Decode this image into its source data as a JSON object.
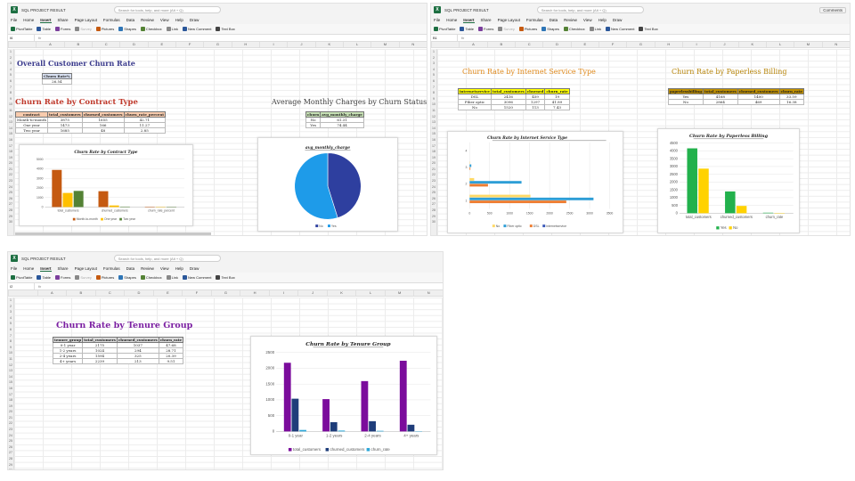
{
  "app": {
    "file_title": "SQL PROJECT RESULT",
    "search_placeholder": "Search for tools, help, and more (Alt + Q)",
    "menu": [
      "File",
      "Home",
      "Insert",
      "Share",
      "Page Layout",
      "Formulas",
      "Data",
      "Review",
      "View",
      "Help",
      "Draw"
    ],
    "active_menu": "Insert",
    "toolbar": [
      "PivotTable",
      "Table",
      "Forms",
      "Survey",
      "Pictures",
      "Shapes",
      "Checkbox",
      "Link",
      "New Comment",
      "Text Box"
    ],
    "comments_label": "Comments",
    "columns": [
      "A",
      "B",
      "C",
      "D",
      "E",
      "F",
      "G",
      "H",
      "I",
      "J",
      "K",
      "L",
      "M",
      "N"
    ]
  },
  "shot_a": {
    "cell_ref": "I6",
    "title_overall": "Overall Customer Churn Rate",
    "overall_header": "Churn Rate%",
    "overall_value": "26.54",
    "title_contract": "Churn Rate by Contract Type",
    "contract_headers": [
      "contract",
      "total_customers",
      "churned_customers",
      "churn_rate_percent"
    ],
    "contract_rows": [
      [
        "Month-to-month",
        "3875",
        "1655",
        "42.71"
      ],
      [
        "One year",
        "1473",
        "166",
        "11.27"
      ],
      [
        "Two year",
        "1685",
        "48",
        "2.85"
      ]
    ],
    "title_monthly": "Average Monthly Charges by Churn Status",
    "monthly_headers": [
      "churn",
      "avg_monthly_charge"
    ],
    "monthly_rows": [
      [
        "No",
        "61.31"
      ],
      [
        "Yes",
        "74.44"
      ]
    ]
  },
  "shot_b": {
    "cell_ref": "B1",
    "title_internet": "Churn Rate by Internet Service Type",
    "internet_headers": [
      "internetservice",
      "total_customers",
      "churned",
      "churn_rate"
    ],
    "internet_rows": [
      [
        "DSL",
        "2416",
        "459",
        "19"
      ],
      [
        "Fiber optic",
        "3096",
        "1297",
        "41.89"
      ],
      [
        "No",
        "1520",
        "113",
        "7.43"
      ]
    ],
    "title_paperless": "Churn Rate by Paperless Billing",
    "paperless_headers": [
      "paperlessbilling",
      "total_customers",
      "churned_customers",
      "churn_rate"
    ],
    "paperless_rows": [
      [
        "Yes",
        "4168",
        "1400",
        "33.59"
      ],
      [
        "No",
        "2864",
        "469",
        "16.38"
      ]
    ]
  },
  "shot_c": {
    "cell_ref": "I2",
    "title_tenure": "Churn Rate by Tenure Group",
    "tenure_headers": [
      "tenure_group",
      "total_customers",
      "churned_customers",
      "churn_rate"
    ],
    "tenure_rows": [
      [
        "0-1 year",
        "2175",
        "1037",
        "47.68"
      ],
      [
        "1-2 years",
        "1024",
        "294",
        "28.71"
      ],
      [
        "2-4 years",
        "1594",
        "325",
        "20.39"
      ],
      [
        "4+ years",
        "2239",
        "213",
        "9.51"
      ]
    ]
  },
  "chart_data": [
    {
      "type": "bar",
      "title": "Churn Rate by Contract Type",
      "categories": [
        "total_customers",
        "churned_customers",
        "churn_rate_percent"
      ],
      "series": [
        {
          "name": "Month-to-month",
          "values": [
            3875,
            1655,
            42.71
          ],
          "color": "#c55a11"
        },
        {
          "name": "One year",
          "values": [
            1473,
            166,
            11.27
          ],
          "color": "#ffc000"
        },
        {
          "name": "Two year",
          "values": [
            1685,
            48,
            2.85
          ],
          "color": "#548235"
        }
      ],
      "ylim": [
        0,
        5000
      ],
      "yticks": [
        0,
        1000,
        2000,
        3000,
        4000,
        5000
      ],
      "legend": "bottom"
    },
    {
      "type": "pie",
      "title": "avg_monthly_charge",
      "categories": [
        "No",
        "Yes"
      ],
      "values": [
        61.31,
        74.44
      ],
      "colors": [
        "#2e3f9f",
        "#1e9be9"
      ],
      "legend": "bottom"
    },
    {
      "type": "bar",
      "orientation": "horizontal",
      "title": "Churn Rate by Internet Service Type",
      "categories": [
        "1",
        "2",
        "3",
        "4"
      ],
      "series": [
        {
          "name": "No",
          "values": [
            1520,
            113,
            7.43,
            0
          ],
          "color": "#ffd966"
        },
        {
          "name": "Fiber optic",
          "values": [
            3096,
            1297,
            41.89,
            0
          ],
          "color": "#2e9ed6"
        },
        {
          "name": "DSL",
          "values": [
            2416,
            459,
            19,
            0
          ],
          "color": "#ed7d31"
        },
        {
          "name": "internetservice",
          "values": [
            0,
            0,
            0,
            0
          ],
          "color": "#3a57b8"
        }
      ],
      "xlim": [
        0,
        3500
      ],
      "xticks": [
        0,
        500,
        1000,
        1500,
        2000,
        2500,
        3000,
        3500
      ],
      "legend": "bottom"
    },
    {
      "type": "bar",
      "title": "Churn Rate by Paperless Billing",
      "categories": [
        "total_customers",
        "churned_customers",
        "churn_rate"
      ],
      "series": [
        {
          "name": "Yes",
          "values": [
            4168,
            1400,
            33.59
          ],
          "color": "#22b14c"
        },
        {
          "name": "No",
          "values": [
            2864,
            469,
            16.38
          ],
          "color": "#ffd200"
        }
      ],
      "ylim": [
        0,
        4500
      ],
      "yticks": [
        0,
        500,
        1000,
        1500,
        2000,
        2500,
        3000,
        3500,
        4000,
        4500
      ],
      "legend": "bottom"
    },
    {
      "type": "bar",
      "title": "Churn Rate by Tenure Group",
      "categories": [
        "0-1 year",
        "1-2 years",
        "2-4 years",
        "4+ years"
      ],
      "series": [
        {
          "name": "total_customers",
          "values": [
            2175,
            1024,
            1594,
            2239
          ],
          "color": "#7b0c9c"
        },
        {
          "name": "churned_customers",
          "values": [
            1037,
            294,
            325,
            213
          ],
          "color": "#1f3d7a"
        },
        {
          "name": "churn_rate",
          "values": [
            47.68,
            28.71,
            20.39,
            9.51
          ],
          "color": "#2ea7d8"
        }
      ],
      "ylim": [
        0,
        2500
      ],
      "yticks": [
        0,
        500,
        1000,
        1500,
        2000,
        2500
      ],
      "legend": "bottom"
    }
  ]
}
